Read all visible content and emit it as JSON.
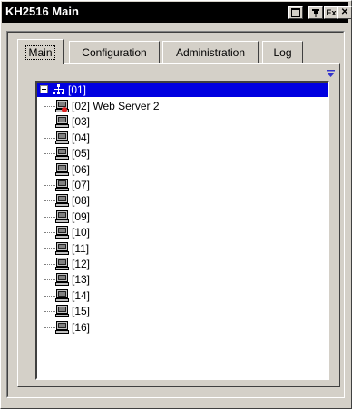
{
  "window": {
    "title": "KH2516 Main",
    "buttons": {
      "restore_icon": "restore-icon",
      "pin_label": "▼",
      "exit_label": "Ex",
      "close_label": "✕"
    }
  },
  "tabs": [
    {
      "label": "Main",
      "active": true
    },
    {
      "label": "Configuration",
      "active": false
    },
    {
      "label": "Administration",
      "active": false
    },
    {
      "label": "Log",
      "active": false
    }
  ],
  "tree": {
    "root": {
      "label": "[01]",
      "icon": "network-icon",
      "selected": true
    },
    "ports": [
      {
        "label": "[02] Web Server 2",
        "icon": "computer-online-icon"
      },
      {
        "label": "[03]",
        "icon": "computer-icon"
      },
      {
        "label": "[04]",
        "icon": "computer-icon"
      },
      {
        "label": "[05]",
        "icon": "computer-icon"
      },
      {
        "label": "[06]",
        "icon": "computer-icon"
      },
      {
        "label": "[07]",
        "icon": "computer-icon"
      },
      {
        "label": "[08]",
        "icon": "computer-icon"
      },
      {
        "label": "[09]",
        "icon": "computer-icon"
      },
      {
        "label": "[10]",
        "icon": "computer-icon"
      },
      {
        "label": "[11]",
        "icon": "computer-icon"
      },
      {
        "label": "[12]",
        "icon": "computer-icon"
      },
      {
        "label": "[13]",
        "icon": "computer-icon"
      },
      {
        "label": "[14]",
        "icon": "computer-icon"
      },
      {
        "label": "[15]",
        "icon": "computer-icon"
      },
      {
        "label": "[16]",
        "icon": "computer-icon"
      }
    ]
  },
  "colors": {
    "selection": "#0000e0",
    "face": "#d4d0c8",
    "dropdown_arrow": "#3333cc",
    "online_marker": "#e02020"
  }
}
